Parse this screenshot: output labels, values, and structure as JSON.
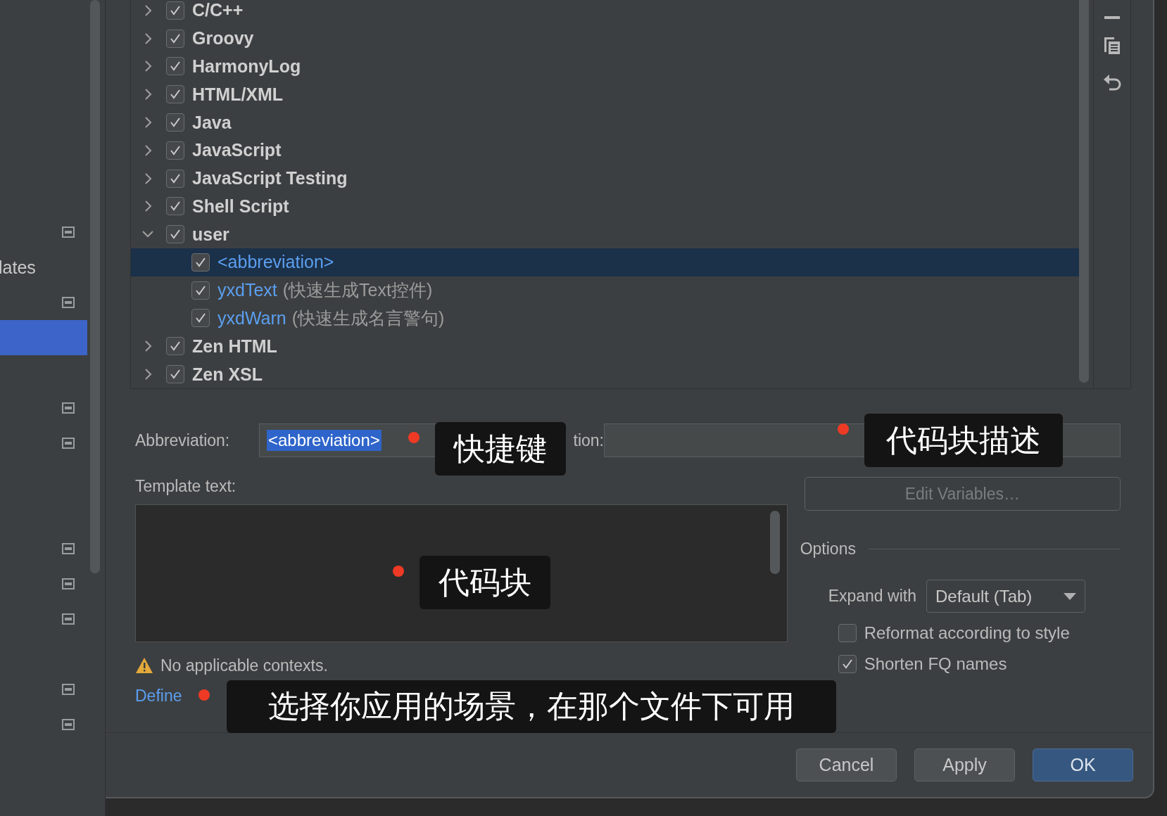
{
  "sidebar": {
    "items": [
      {
        "kind": "icon",
        "selected": false
      },
      {
        "kind": "label",
        "text": "lates",
        "selected": false
      },
      {
        "kind": "icon",
        "selected": false
      },
      {
        "kind": "blank",
        "selected": true
      },
      {
        "kind": "blank",
        "selected": false
      },
      {
        "kind": "icon",
        "selected": false
      },
      {
        "kind": "icon",
        "selected": false
      },
      {
        "kind": "blank",
        "selected": false
      },
      {
        "kind": "blank",
        "selected": false
      },
      {
        "kind": "icon",
        "selected": false
      },
      {
        "kind": "icon",
        "selected": false
      },
      {
        "kind": "icon",
        "selected": false
      },
      {
        "kind": "blank",
        "selected": false
      },
      {
        "kind": "icon",
        "selected": false
      },
      {
        "kind": "icon",
        "selected": false
      }
    ]
  },
  "template_groups": [
    {
      "name": "C/C++",
      "checked": true,
      "expanded": false
    },
    {
      "name": "Groovy",
      "checked": true,
      "expanded": false
    },
    {
      "name": "HarmonyLog",
      "checked": true,
      "expanded": false
    },
    {
      "name": "HTML/XML",
      "checked": true,
      "expanded": false
    },
    {
      "name": "Java",
      "checked": true,
      "expanded": false
    },
    {
      "name": "JavaScript",
      "checked": true,
      "expanded": false
    },
    {
      "name": "JavaScript Testing",
      "checked": true,
      "expanded": false
    },
    {
      "name": "Shell Script",
      "checked": true,
      "expanded": false
    },
    {
      "name": "user",
      "checked": true,
      "expanded": true,
      "children": [
        {
          "name": "<abbreviation>",
          "checked": true,
          "selected": true
        },
        {
          "name": "yxdText",
          "description": "(快速生成Text控件)",
          "checked": true,
          "selected": false
        },
        {
          "name": "yxdWarn",
          "description": "(快速生成名言警句)",
          "checked": true,
          "selected": false
        }
      ]
    },
    {
      "name": "Zen HTML",
      "checked": true,
      "expanded": false
    },
    {
      "name": "Zen XSL",
      "checked": true,
      "expanded": false
    }
  ],
  "abbreviation": {
    "label": "Abbreviation:",
    "value": "<abbreviation>"
  },
  "description": {
    "label": "tion:"
  },
  "template_text": {
    "label": "Template text:"
  },
  "edit_variables_button": {
    "label": "Edit Variables…",
    "disabled": true
  },
  "options": {
    "title": "Options",
    "expand_with": {
      "label": "Expand with",
      "value": "Default (Tab)"
    },
    "checkboxes": [
      {
        "label": "Reformat according to style",
        "checked": false
      },
      {
        "label": "Shorten FQ names",
        "checked": true
      }
    ]
  },
  "contexts": {
    "warning": "No applicable contexts.",
    "link": "Define"
  },
  "annotations": [
    {
      "text": "快捷键"
    },
    {
      "text": "代码块描述"
    },
    {
      "text": "代码块"
    },
    {
      "text": "选择你应用的场景，在那个文件下可用"
    }
  ],
  "buttons": [
    {
      "label": "Cancel",
      "kind": "normal"
    },
    {
      "label": "Apply",
      "kind": "normal"
    },
    {
      "label": "OK",
      "kind": "default"
    }
  ]
}
